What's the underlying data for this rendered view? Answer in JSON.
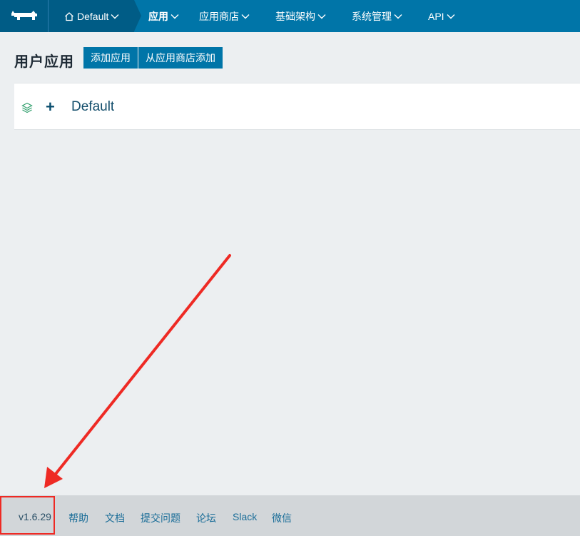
{
  "topnav": {
    "logo_icon": "rancher-cow-icon",
    "environment": {
      "icon": "home-icon",
      "label": "Default"
    },
    "items": [
      {
        "label": "应用",
        "active": true
      },
      {
        "label": "应用商店",
        "active": false
      },
      {
        "label": "基础架构",
        "active": false
      },
      {
        "label": "系统管理",
        "active": false
      },
      {
        "label": "API",
        "active": false
      }
    ]
  },
  "header": {
    "title": "用户应用",
    "add_app_label": "添加应用",
    "add_from_catalog_label": "从应用商店添加"
  },
  "stacks": [
    {
      "icon": "stack-layers-icon",
      "expand_icon": "plus-icon",
      "expand_symbol": "+",
      "name": "Default"
    }
  ],
  "footer": {
    "version": "v1.6.29",
    "links": [
      "帮助",
      "文档",
      "提交问题",
      "论坛",
      "Slack",
      "微信"
    ]
  },
  "colors": {
    "nav_bg": "#0075a8",
    "nav_dark": "#005c86",
    "page_bg": "#eceff1",
    "footer_bg": "#d2d6d9",
    "annotation": "#ee2a24",
    "link": "#1a6d98"
  }
}
